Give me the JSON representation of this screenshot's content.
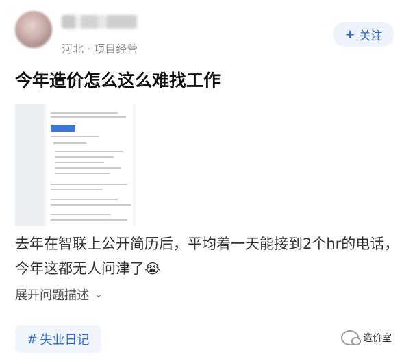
{
  "post": {
    "meta": "河北 · 项目经营",
    "follow_label": "关注",
    "title": "今年造价怎么这么难找工作",
    "description": "去年在智联上公开简历后，平均着一天能接到2个hr的电话，今年这都无人问津了",
    "emoji": "😭",
    "expand_label": "展开问题描述",
    "topic_tag": "失业日记"
  },
  "icons": {
    "follow": "plus-icon",
    "expand": "chevron-down-icon",
    "tag": "hash-icon",
    "brand": "wechat-icon"
  },
  "watermark": {
    "label": "造价室"
  },
  "colors": {
    "accent": "#2f6bd6",
    "follow_bg": "#eef3fb",
    "tag_bg": "#f0f4fb"
  }
}
